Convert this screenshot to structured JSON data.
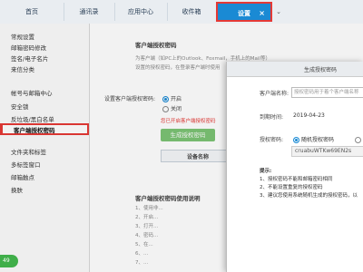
{
  "tabs": [
    {
      "label": "首页"
    },
    {
      "label": "通讯录"
    },
    {
      "label": "应用中心"
    },
    {
      "label": "收件箱"
    },
    {
      "label": "设置",
      "close": "×"
    }
  ],
  "tab_more": "⌄",
  "sidebar": {
    "items": [
      {
        "label": "常规设置"
      },
      {
        "label": "邮箱密码修改"
      },
      {
        "label": "签名/电子名片"
      },
      {
        "label": "来信分类"
      },
      {
        "label": "帐号与邮箱中心"
      },
      {
        "label": "安全锁"
      },
      {
        "label": "反垃圾/黑白名单"
      },
      {
        "label": "客户端授权密码"
      },
      {
        "label": "文件夹和标签"
      },
      {
        "label": "多标签窗口"
      },
      {
        "label": "邮箱触点"
      },
      {
        "label": "换肤"
      }
    ]
  },
  "main": {
    "section_title": "客户端授权密码",
    "desc1": "为客户端（如PC上的Outlook、Foxmail，手机上的Mail等）",
    "desc2": "设置的授权密码，在登录客户端时使用",
    "enable_label": "设置客户端授权密码:",
    "opt_on": "开启",
    "opt_off": "关闭",
    "warning": "您已开启客户端授权密码",
    "gen_button": "生成授权密码",
    "col_device": "设备名称",
    "section2_title": "客户端授权密码使用说明",
    "notes": [
      "1、使用非...",
      "2、开启...",
      "3、打开...",
      "4、密码...",
      "5、在...",
      "6、...",
      "7、..."
    ]
  },
  "modal": {
    "title": "生成授权密码",
    "name_label": "客户端名称:",
    "name_placeholder": "授权密码用于着个客户端名称",
    "expire_label": "到期时间:",
    "expire_value": "2019-04-23",
    "pwd_label": "授权密码:",
    "random_option": "随机授权密码",
    "custom_option": "自",
    "code_value": "cruabuWTKw69EN2s",
    "tips_title": "提示:",
    "tips": [
      "1、授权密码不能和邮箱密码相同",
      "2、不能设置重复的授权密码",
      "3、建议您使用系统随机生成的授权密码，以"
    ]
  },
  "badge": "49"
}
